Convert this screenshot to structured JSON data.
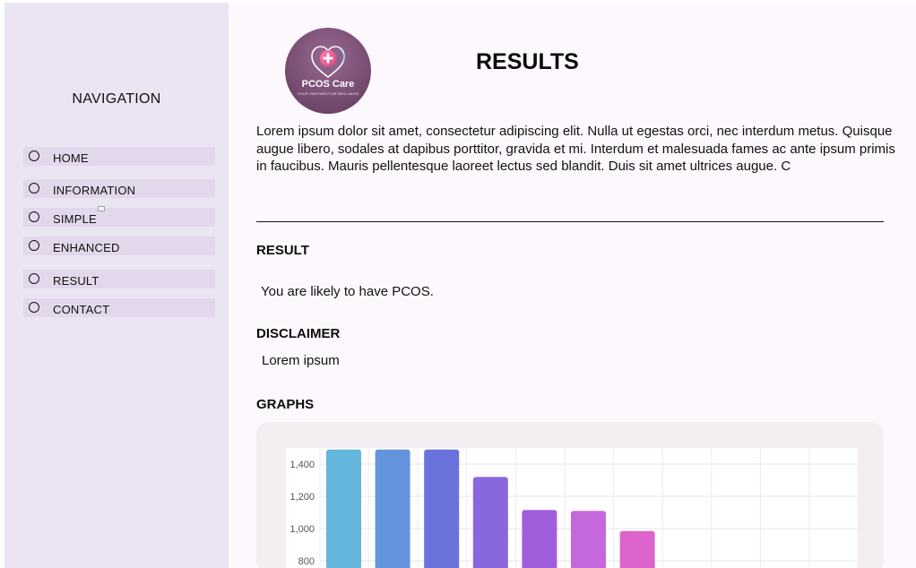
{
  "sidebar": {
    "title": "NAVIGATION",
    "items": [
      {
        "label": "HOME"
      },
      {
        "label": "INFORMATION"
      },
      {
        "label": "SIMPLE"
      },
      {
        "label": "ENHANCED"
      },
      {
        "label": "RESULT"
      },
      {
        "label": "CONTACT"
      }
    ]
  },
  "header": {
    "logo_text": "PCOS Care",
    "logo_tagline": "YOUR PARTNER FOR WELLNESS",
    "title": "RESULTS"
  },
  "intro": "Lorem ipsum dolor sit amet, consectetur adipiscing elit. Nulla ut egestas orci, nec interdum metus. Quisque augue libero, sodales at dapibus porttitor, gravida et mi. Interdum et malesuada fames ac ante ipsum primis in faucibus. Mauris pellentesque laoreet lectus sed blandit. Duis sit amet ultrices augue. C",
  "result": {
    "heading": "RESULT",
    "text": "You are likely to have PCOS."
  },
  "disclaimer": {
    "heading": "DISCLAIMER",
    "text": "Lorem ipsum"
  },
  "graphs": {
    "heading": "GRAPHS"
  },
  "colors": {
    "sidebar_bg": "#ebe4f2",
    "nav_item_bg": "#e3d7ec",
    "main_bg": "#fdf8fd",
    "chart_card_bg": "#f3eef2"
  },
  "chart_data": {
    "type": "bar",
    "ylim": [
      780,
      1500
    ],
    "yticks": [
      800,
      1000,
      1200,
      1400
    ],
    "ytick_labels": [
      "800",
      "1,000",
      "1,200",
      "1,400"
    ],
    "grid": true,
    "num_slots": 11,
    "values": [
      1490,
      1490,
      1490,
      1320,
      1115,
      1110,
      985
    ],
    "bar_colors": [
      "#64b6dc",
      "#6495dc",
      "#6a72dc",
      "#8868dc",
      "#a05edc",
      "#c468dc",
      "#dc64cc"
    ]
  }
}
